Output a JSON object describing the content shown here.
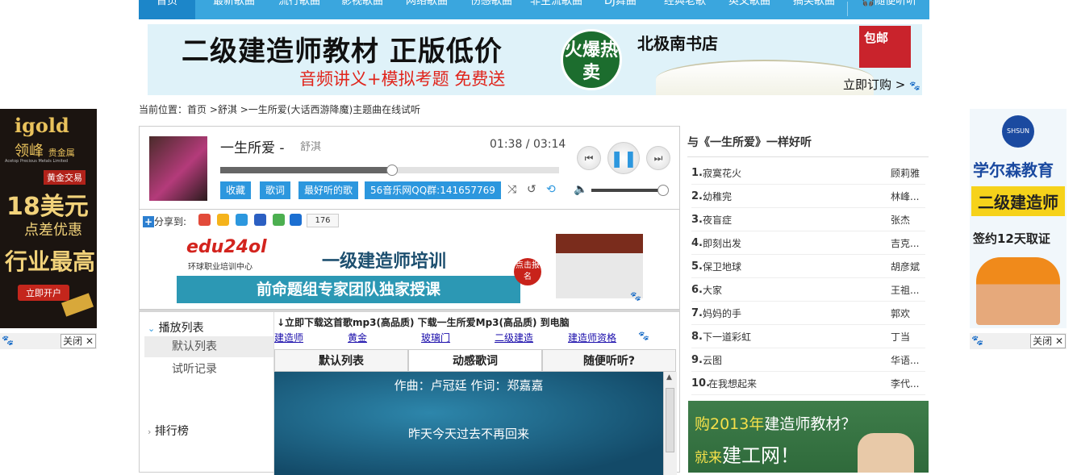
{
  "nav": {
    "items": [
      "首页",
      "最新歌曲",
      "流行歌曲",
      "影视歌曲",
      "网络歌曲",
      "伤感歌曲",
      "非主流歌曲",
      "DJ舞曲",
      "经典老歌",
      "英文歌曲",
      "搞笑歌曲",
      "随便听听"
    ],
    "active_index": 0,
    "headphone_icon": "headphones-icon"
  },
  "top_ad": {
    "title": "二级建造师教材 正版低价",
    "subtitle": "音频讲义+模拟考题 免费送",
    "hot_label": "火爆热卖",
    "store": "北极南书店",
    "mail_label": "包邮",
    "order": "立即订购 >"
  },
  "breadcrumb": {
    "prefix": "当前位置：",
    "home": "首页",
    "sep1": " >",
    "artist": "舒淇",
    "sep2": " >",
    "current": "一生所爱(大话西游降魔)主题曲在线试听"
  },
  "left_ad": {
    "brand": "igold",
    "brand_cn": "领峰",
    "brand_sub": "贵金属",
    "company": "Acetop Precious Metals Limited",
    "tag": "黄金交易",
    "offer_amount": "18美元",
    "offer_text": "点差优惠",
    "slogan": "行业最高",
    "cta": "立即开户",
    "close": "关闭 ✕"
  },
  "right_ad": {
    "badge": "SHSUN",
    "brand": "学尔森教育",
    "course": "二级建造师",
    "promo": "签约12天取证",
    "close": "关闭 ✕"
  },
  "player": {
    "title": "一生所爱 -",
    "artist": "舒淇",
    "time": "01:38 / 03:14",
    "progress_fraction": 0.505,
    "volume_fraction": 0.98,
    "buttons": [
      "收藏",
      "歌词",
      "最好听的歌",
      "56音乐网QQ群:141657769"
    ],
    "icons": [
      "shuffle-icon",
      "repeat-one-icon",
      "repeat-icon",
      "volume-icon",
      "prev-icon",
      "pause-icon",
      "next-icon"
    ]
  },
  "share": {
    "label": "分享到:",
    "count": "176"
  },
  "mid_ad": {
    "logo": "edu24ol",
    "logo_sub": "环球职业培训中心",
    "headline": "一级建造师培训",
    "bar": "前命题组专家团队独家授课",
    "badge": "点击报名"
  },
  "sidebar_menu": {
    "playlist_head": "播放列表",
    "items": [
      "默认列表",
      "试听记录"
    ],
    "rank_head": "排行榜"
  },
  "download": {
    "line": "↓立即下载这首歌mp3(高品质)   下载一生所爱Mp3(高品质) 到电脑",
    "links": [
      "建造师",
      "黄金",
      "玻璃门",
      "二级建造",
      "建造师资格"
    ]
  },
  "tabs": [
    "默认列表",
    "动感歌词",
    "随便听听?"
  ],
  "tabs_active": 1,
  "lyrics": {
    "line1": "作曲：卢冠廷 作词：郑嘉嘉",
    "line2": "昨天今天过去不再回来"
  },
  "recommend": {
    "title": "与《一生所爱》一样好听",
    "items": [
      {
        "num": "1.",
        "name": "寂寞花火",
        "artist": "顾莉雅"
      },
      {
        "num": "2.",
        "name": "幼稚完",
        "artist": "林峰..."
      },
      {
        "num": "3.",
        "name": "夜盲症",
        "artist": "张杰"
      },
      {
        "num": "4.",
        "name": "即刻出发",
        "artist": "吉克..."
      },
      {
        "num": "5.",
        "name": "保卫地球",
        "artist": "胡彦斌"
      },
      {
        "num": "6.",
        "name": "大家",
        "artist": "王祖..."
      },
      {
        "num": "7.",
        "name": "妈妈的手",
        "artist": "郭欢"
      },
      {
        "num": "8.",
        "name": "下一道彩虹",
        "artist": "丁当"
      },
      {
        "num": "9.",
        "name": "云图",
        "artist": "华语..."
      },
      {
        "num": "10.",
        "name": "在我想起来",
        "artist": "李代..."
      }
    ]
  },
  "bottom_ad": {
    "line1_a": "购2013年",
    "line1_b": "建造师教材？",
    "line2_a": "就来",
    "line2_b": "建工网！"
  }
}
